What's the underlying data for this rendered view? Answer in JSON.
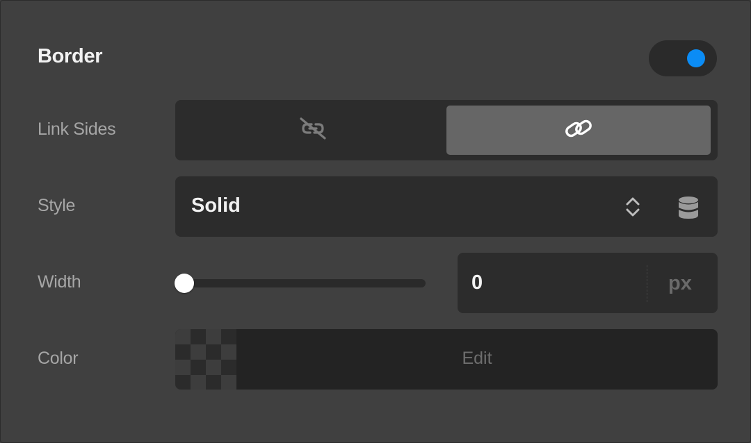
{
  "section": {
    "title": "Border",
    "enabled": true,
    "accent_color": "#0b8cf5"
  },
  "link_sides": {
    "label": "Link Sides",
    "options": [
      {
        "icon": "unlink-icon",
        "selected": false
      },
      {
        "icon": "link-icon",
        "selected": true
      }
    ]
  },
  "style": {
    "label": "Style",
    "value": "Solid",
    "icons": [
      "chevron-up-down-icon",
      "database-icon"
    ]
  },
  "width": {
    "label": "Width",
    "slider_value": 0,
    "value": "0",
    "unit": "px"
  },
  "color": {
    "label": "Color",
    "edit_label": "Edit",
    "swatch": "transparent"
  }
}
